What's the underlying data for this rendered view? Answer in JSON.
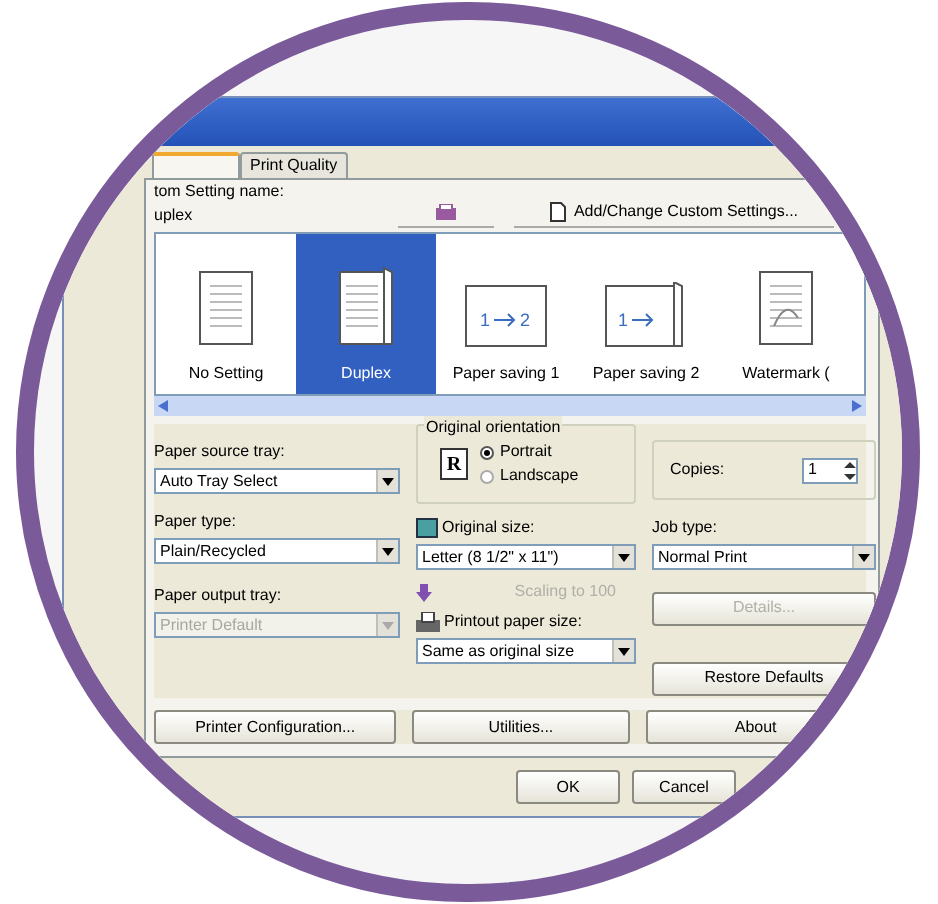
{
  "tabs": [
    {
      "selected": true
    },
    {
      "label": "Print Quality",
      "selected": false
    }
  ],
  "custom_setting": {
    "label": "tom Setting name:",
    "value": "uplex",
    "add_button": "Add/Change Custom Settings..."
  },
  "settings": [
    {
      "label": "No Setting",
      "kind": "plain",
      "selected": false
    },
    {
      "label": "Duplex",
      "kind": "duplex",
      "selected": true
    },
    {
      "label": "Paper saving 1",
      "kind": "saving1",
      "selected": false,
      "page_numbers": [
        "1",
        "2"
      ]
    },
    {
      "label": "Paper saving 2",
      "kind": "saving2",
      "selected": false,
      "page_numbers": [
        "1"
      ]
    },
    {
      "label": "Watermark (",
      "kind": "watermark",
      "selected": false
    }
  ],
  "paper_source": {
    "label": "Paper source tray:",
    "value": "Auto Tray Select",
    "disabled": false
  },
  "paper_type": {
    "label": "Paper type:",
    "value": "Plain/Recycled",
    "disabled": false
  },
  "paper_output": {
    "label": "Paper output tray:",
    "value": "Printer Default",
    "disabled": true
  },
  "orientation": {
    "label": "Original orientation",
    "icon_letter": "R",
    "options": [
      {
        "label": "Portrait",
        "selected": true
      },
      {
        "label": "Landscape",
        "selected": false
      }
    ]
  },
  "copies": {
    "label": "Copies:",
    "value": "1"
  },
  "original_size": {
    "label": "Original size:",
    "value": "Letter (8 1/2\" x 11\")",
    "disabled": false
  },
  "job_type": {
    "label": "Job type:",
    "value": "Normal Print",
    "disabled": false
  },
  "scaling": {
    "label": "Scaling to 100",
    "disabled": true
  },
  "details_button": {
    "label": "Details...",
    "disabled": true
  },
  "printout_size": {
    "label": "Printout paper size:",
    "value": "Same as original size",
    "disabled": false
  },
  "restore_button": "Restore Defaults",
  "bottom_buttons": [
    "Printer Configuration...",
    "Utilities...",
    "About"
  ],
  "dialog_buttons": [
    "OK",
    "Cancel"
  ]
}
